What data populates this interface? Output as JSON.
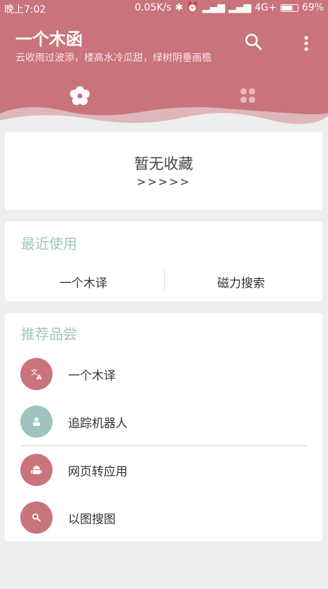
{
  "status_bar": {
    "time": "晚上7:02",
    "speed": "0.05K/s",
    "network": "4G+",
    "battery": "69%"
  },
  "header": {
    "title": "一个木函",
    "subtitle": "云收雨过波添，楼高水冷瓜甜，绿树阴垂画檐"
  },
  "tabs": [
    {
      "icon": "flower-icon",
      "active": true
    },
    {
      "icon": "grid-icon",
      "active": false
    }
  ],
  "favorites": {
    "empty_text": "暂无收藏",
    "arrows": ">>>>>"
  },
  "recent": {
    "title": "最近使用",
    "items": [
      "一个木译",
      "磁力搜索"
    ]
  },
  "recommend": {
    "title": "推荐品尝",
    "items": [
      {
        "label": "一个木译",
        "icon": "translate-icon",
        "color": "#c9737a"
      },
      {
        "label": "追踪机器人",
        "icon": "person-icon",
        "color": "#9fc4bf"
      },
      {
        "label": "网页转应用",
        "icon": "android-icon",
        "color": "#c9737a"
      },
      {
        "label": "以图搜图",
        "icon": "search-icon",
        "color": "#c9737a"
      }
    ]
  },
  "colors": {
    "accent": "#c9737a",
    "teal": "#9fc4bf",
    "background": "#eeeeee"
  }
}
